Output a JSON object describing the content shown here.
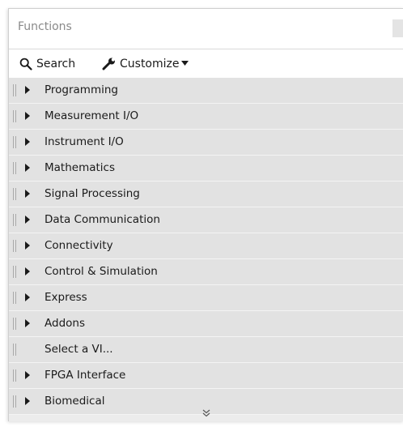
{
  "palette": {
    "title": "Functions",
    "toolbar": {
      "search_label": "Search",
      "customize_label": "Customize"
    },
    "items": [
      {
        "label": "Programming",
        "expandable": true
      },
      {
        "label": "Measurement I/O",
        "expandable": true
      },
      {
        "label": "Instrument I/O",
        "expandable": true
      },
      {
        "label": "Mathematics",
        "expandable": true
      },
      {
        "label": "Signal Processing",
        "expandable": true
      },
      {
        "label": "Data Communication",
        "expandable": true
      },
      {
        "label": "Connectivity",
        "expandable": true
      },
      {
        "label": "Control & Simulation",
        "expandable": true
      },
      {
        "label": "Express",
        "expandable": true
      },
      {
        "label": "Addons",
        "expandable": true
      },
      {
        "label": "Select a VI...",
        "expandable": false
      },
      {
        "label": "FPGA Interface",
        "expandable": true
      },
      {
        "label": "Biomedical",
        "expandable": true
      }
    ],
    "icons": {
      "search": "search-icon",
      "customize": "wrench-icon",
      "dropdown": "caret-down-icon",
      "expand": "triangle-right-icon",
      "more": "double-chevron-down-icon"
    },
    "colors": {
      "row_background": "#e2e2e2",
      "panel_background": "#ececec",
      "title_text": "#8a8a8a"
    }
  }
}
